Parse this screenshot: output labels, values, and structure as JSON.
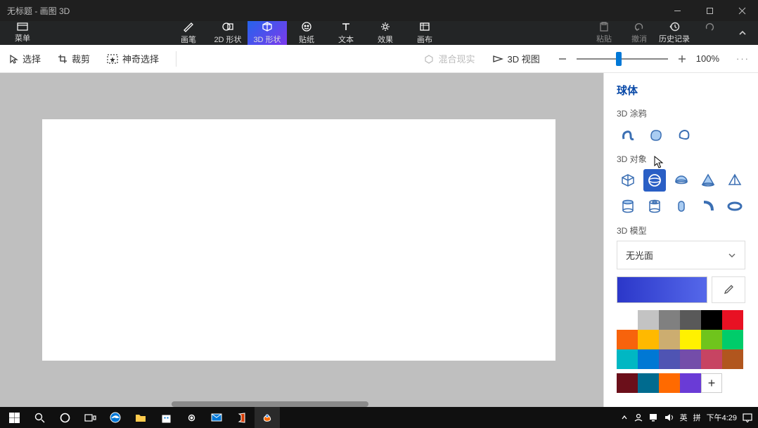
{
  "window": {
    "title": "无标题 - 画图 3D"
  },
  "menu": {
    "label": "菜单"
  },
  "tabs": [
    {
      "label": "画笔",
      "icon": "brush-icon"
    },
    {
      "label": "2D 形状",
      "icon": "shape2d-icon"
    },
    {
      "label": "3D 形状",
      "icon": "shape3d-icon",
      "selected": true
    },
    {
      "label": "贴纸",
      "icon": "sticker-icon"
    },
    {
      "label": "文本",
      "icon": "text-icon"
    },
    {
      "label": "效果",
      "icon": "effects-icon"
    },
    {
      "label": "画布",
      "icon": "canvas-icon"
    }
  ],
  "right_tools": [
    {
      "label": "粘贴",
      "icon": "paste-icon"
    },
    {
      "label": "撤消",
      "icon": "undo-icon"
    },
    {
      "label": "历史记录",
      "icon": "history-icon"
    },
    {
      "label": "重做",
      "icon": "redo-icon"
    }
  ],
  "toolbar": {
    "select": "选择",
    "crop": "裁剪",
    "magic_select": "神奇选择",
    "mixed_reality": "混合现实",
    "view3d": "3D 视图",
    "zoom_pct": "100%"
  },
  "sidepanel": {
    "heading": "球体",
    "doodle_label": "3D 涂鸦",
    "objects_label": "3D 对象",
    "models_label": "3D 模型",
    "material": "无光面",
    "color_current": "#3a4dd0",
    "palette": [
      "#ffffff",
      "#c3c3c3",
      "#808080",
      "#595959",
      "#000000",
      "#e81123",
      "#f7630c",
      "#ffb900",
      "#ccad70",
      "#fff100",
      "#6fc41c",
      "#00cc6a",
      "#00b7c3",
      "#0078d4",
      "#4f54b3",
      "#744da9",
      "#c74462",
      "#b1561e"
    ],
    "custom_palette": [
      "#6b0f1a",
      "#006b8f",
      "#ff6a00",
      "#6a3bd6"
    ],
    "add_swatch": "+"
  },
  "doodle_shapes": [
    "tube-doodle",
    "soft-doodle",
    "flat-doodle"
  ],
  "object_shapes": [
    "cube",
    "sphere",
    "hemisphere",
    "cone",
    "pyramid",
    "cylinder",
    "cylinder-hole",
    "capsule",
    "curve",
    "torus"
  ],
  "selected_object": "sphere",
  "taskbar": {
    "ime_lang": "英",
    "ime_mode": "拼",
    "time": "下午4:29"
  }
}
